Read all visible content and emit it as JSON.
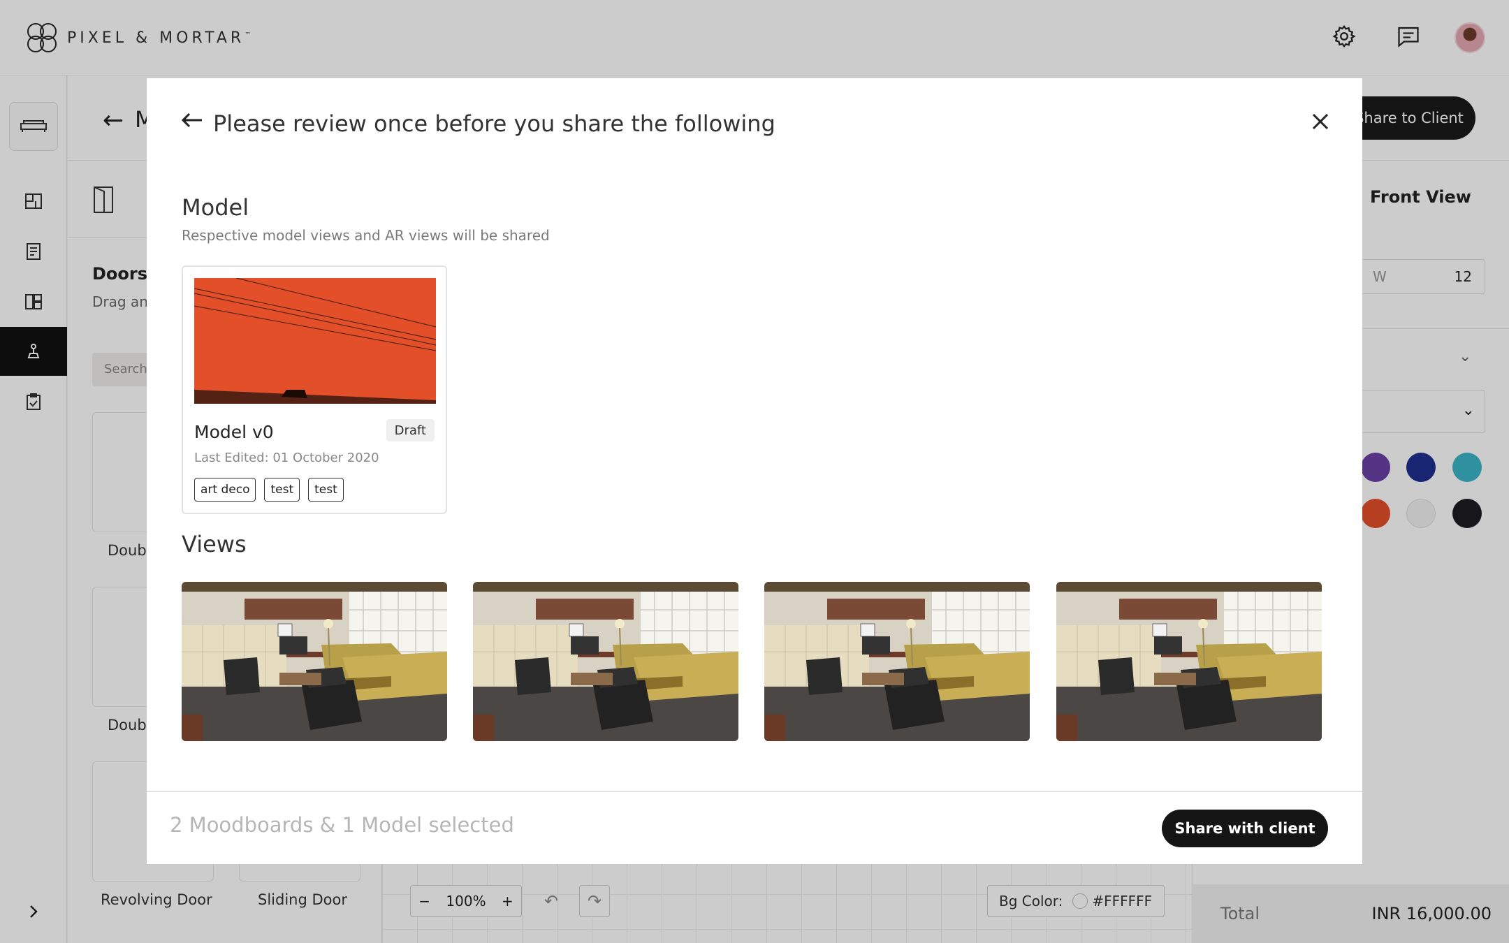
{
  "app": {
    "brand": "PIXEL & MORTAR",
    "brand_tm": "™",
    "header_icons": [
      "gear-icon",
      "chat-icon",
      "bell-icon",
      "avatar"
    ]
  },
  "subheader": {
    "title_fragment": "M",
    "share_button": "Share to Client"
  },
  "left_panel": {
    "title": "Doors",
    "subtitle": "Drag and drop to add to your walls",
    "search_placeholder": "Search",
    "items": [
      {
        "label": "Double Door"
      },
      {
        "label": "Double Door"
      },
      {
        "label": "Revolving Door"
      },
      {
        "label": "Sliding Door"
      }
    ]
  },
  "canvas": {
    "zoom": "100%",
    "bg_label": "Bg Color:",
    "bg_value": "#FFFFFF"
  },
  "right_panel": {
    "view_title": "Front View",
    "w_label": "W",
    "w_value": "12",
    "colors": [
      "#6a3fa5",
      "#1f2f8f",
      "#3bb4c7",
      "#e34f29",
      "#f2f2f2",
      "#1d1d22"
    ],
    "total_label": "Total",
    "total_value": "INR 16,000.00"
  },
  "modal": {
    "title": "Please review once before you share the following",
    "model_section": {
      "title": "Model",
      "subtitle": "Respective model views and AR views will be shared",
      "card": {
        "name": "Model v0",
        "status": "Draft",
        "last_edited": "Last Edited: 01 October 2020",
        "tags": [
          "art deco",
          "test",
          "test"
        ],
        "thumb_color": "#e34f29"
      }
    },
    "views_section": {
      "title": "Views",
      "count": 4
    },
    "footer": {
      "status": "2 Moodboards & 1 Model selected",
      "share_button": "Share with client"
    }
  }
}
